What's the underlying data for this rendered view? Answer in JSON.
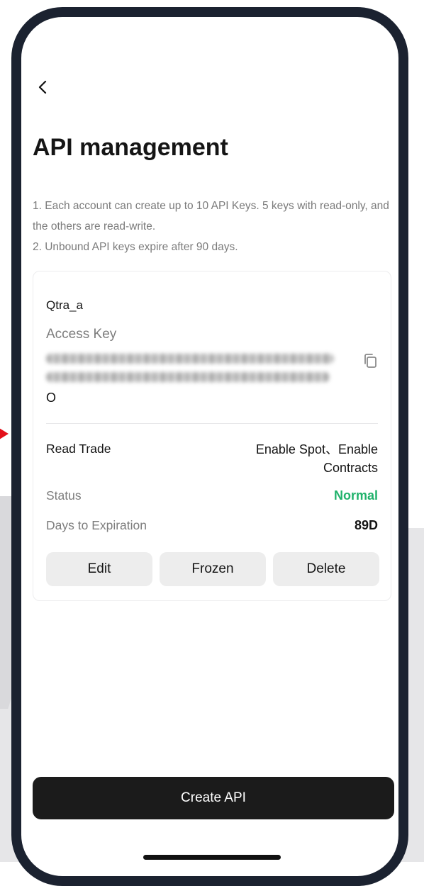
{
  "header": {
    "back_icon": "chevron-left-icon",
    "title": "API management"
  },
  "notice": {
    "line1": "1. Each account can create up to 10 API Keys. 5 keys with read-only, and the others are read-write.",
    "line2": "2. Unbound API keys expire after 90 days."
  },
  "api_card": {
    "name": "Qtra_a",
    "access_key_label": "Access Key",
    "access_key_tail": "O",
    "copy_icon": "copy-icon",
    "permission_label": "Read Trade",
    "permission_value": "Enable Spot、Enable Contracts",
    "status_label": "Status",
    "status_value": "Normal",
    "status_color": "#20b26b",
    "expiration_label": "Days to Expiration",
    "expiration_value": "89D",
    "buttons": {
      "edit": "Edit",
      "frozen": "Frozen",
      "delete": "Delete"
    }
  },
  "footer": {
    "create_label": "Create API"
  },
  "colors": {
    "frame": "#1b2230",
    "primary_button": "#1b1b1b",
    "annotation_arrow": "#e3101a"
  }
}
